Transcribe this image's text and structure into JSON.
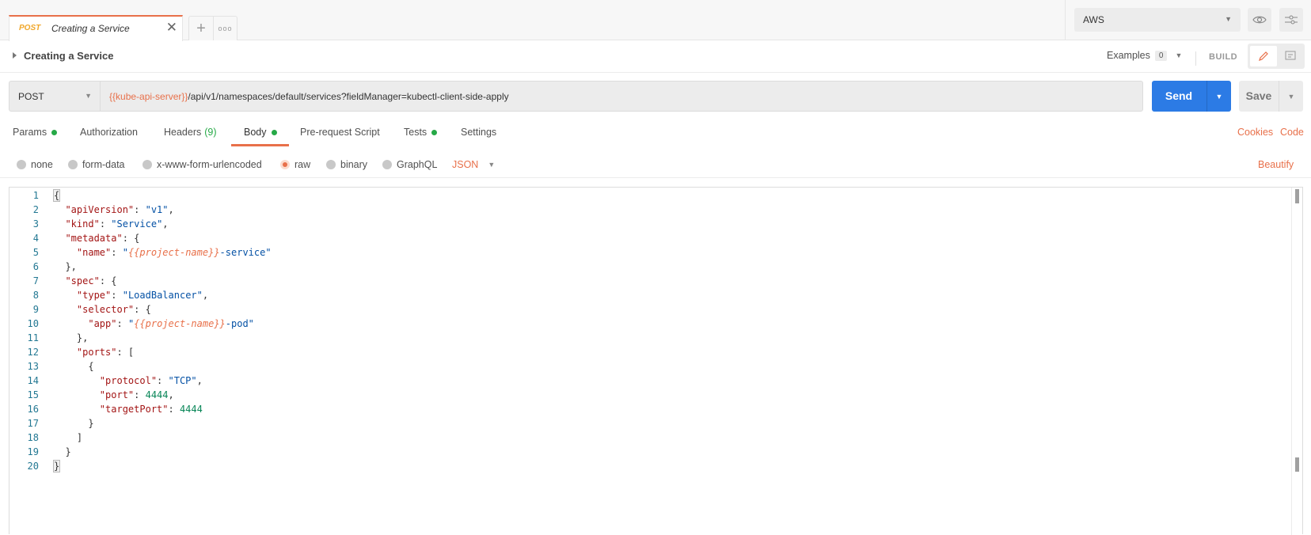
{
  "tabs": {
    "active": {
      "method": "POST",
      "name": "Creating a Service"
    },
    "new_tab_icon": "plus-icon",
    "more_icon": "more-horizontal-icon"
  },
  "environment": {
    "selected": "AWS",
    "options_icon": "chevron-down-icon",
    "quick_look_icon": "eye-icon",
    "manage_icon": "sliders-icon"
  },
  "request": {
    "title": "Creating a Service",
    "examples_label": "Examples",
    "examples_count": "0",
    "build_label": "BUILD",
    "method": "POST",
    "url_variable": "{{kube-api-server}}",
    "url_path": "/api/v1/namespaces/default/services?fieldManager=kubectl-client-side-apply",
    "send_label": "Send",
    "save_label": "Save"
  },
  "subtabs": [
    {
      "label": "Params",
      "dot": true
    },
    {
      "label": "Authorization"
    },
    {
      "label": "Headers",
      "count": "(9)"
    },
    {
      "label": "Body",
      "dot": true,
      "active": true
    },
    {
      "label": "Pre-request Script"
    },
    {
      "label": "Tests",
      "dot": true
    },
    {
      "label": "Settings"
    }
  ],
  "links": {
    "cookies": "Cookies",
    "code": "Code",
    "beautify": "Beautify"
  },
  "body_types": [
    {
      "label": "none"
    },
    {
      "label": "form-data"
    },
    {
      "label": "x-www-form-urlencoded"
    },
    {
      "label": "raw",
      "selected": true
    },
    {
      "label": "binary"
    },
    {
      "label": "GraphQL"
    }
  ],
  "body_language": "JSON",
  "editor": {
    "lines": [
      [
        [
          "p",
          "{"
        ]
      ],
      [
        [
          "p",
          "  "
        ],
        [
          "k",
          "\"apiVersion\""
        ],
        [
          "p",
          ": "
        ],
        [
          "s",
          "\"v1\""
        ],
        [
          "p",
          ","
        ]
      ],
      [
        [
          "p",
          "  "
        ],
        [
          "k",
          "\"kind\""
        ],
        [
          "p",
          ": "
        ],
        [
          "s",
          "\"Service\""
        ],
        [
          "p",
          ","
        ]
      ],
      [
        [
          "p",
          "  "
        ],
        [
          "k",
          "\"metadata\""
        ],
        [
          "p",
          ": {"
        ]
      ],
      [
        [
          "p",
          "    "
        ],
        [
          "k",
          "\"name\""
        ],
        [
          "p",
          ": "
        ],
        [
          "s",
          "\""
        ],
        [
          "v",
          "{{project-name}}"
        ],
        [
          "s",
          "-service\""
        ]
      ],
      [
        [
          "p",
          "  },"
        ]
      ],
      [
        [
          "p",
          "  "
        ],
        [
          "k",
          "\"spec\""
        ],
        [
          "p",
          ": {"
        ]
      ],
      [
        [
          "p",
          "    "
        ],
        [
          "k",
          "\"type\""
        ],
        [
          "p",
          ": "
        ],
        [
          "s",
          "\"LoadBalancer\""
        ],
        [
          "p",
          ","
        ]
      ],
      [
        [
          "p",
          "    "
        ],
        [
          "k",
          "\"selector\""
        ],
        [
          "p",
          ": {"
        ]
      ],
      [
        [
          "p",
          "      "
        ],
        [
          "k",
          "\"app\""
        ],
        [
          "p",
          ": "
        ],
        [
          "s",
          "\""
        ],
        [
          "v",
          "{{project-name}}"
        ],
        [
          "s",
          "-pod\""
        ]
      ],
      [
        [
          "p",
          "    },"
        ]
      ],
      [
        [
          "p",
          "    "
        ],
        [
          "k",
          "\"ports\""
        ],
        [
          "p",
          ": ["
        ]
      ],
      [
        [
          "p",
          "      {"
        ]
      ],
      [
        [
          "p",
          "        "
        ],
        [
          "k",
          "\"protocol\""
        ],
        [
          "p",
          ": "
        ],
        [
          "s",
          "\"TCP\""
        ],
        [
          "p",
          ","
        ]
      ],
      [
        [
          "p",
          "        "
        ],
        [
          "k",
          "\"port\""
        ],
        [
          "p",
          ": "
        ],
        [
          "n",
          "4444"
        ],
        [
          "p",
          ","
        ]
      ],
      [
        [
          "p",
          "        "
        ],
        [
          "k",
          "\"targetPort\""
        ],
        [
          "p",
          ": "
        ],
        [
          "n",
          "4444"
        ]
      ],
      [
        [
          "p",
          "      }"
        ]
      ],
      [
        [
          "p",
          "    ]"
        ]
      ],
      [
        [
          "p",
          "  }"
        ]
      ],
      [
        [
          "p",
          "}"
        ]
      ]
    ]
  }
}
